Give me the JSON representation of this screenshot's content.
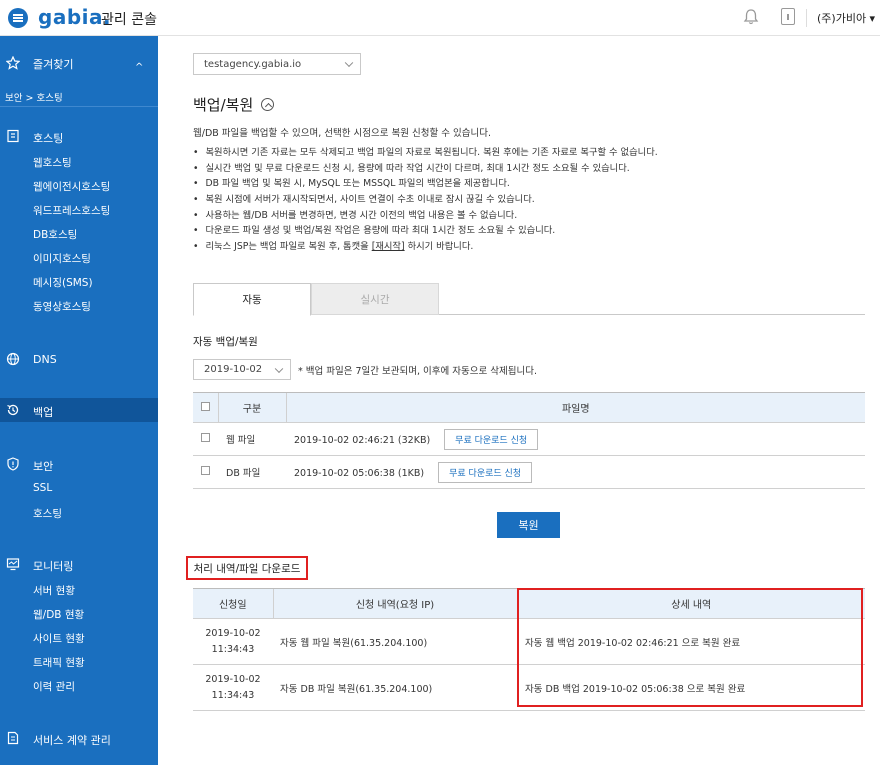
{
  "topbar": {
    "logo": "gabia.",
    "console_label": "관리 콘솔",
    "user": "(주)가비아 ▾"
  },
  "sidebar": {
    "favorites": "즐겨찾기",
    "breadcrumb": "보안 > 호스팅",
    "hosting_title": "호스팅",
    "hosting_items": [
      "웹호스팅",
      "웹에이전시호스팅",
      "워드프레스호스팅",
      "DB호스팅",
      "이미지호스팅",
      "메시징(SMS)",
      "동영상호스팅"
    ],
    "dns": "DNS",
    "backup": "백업",
    "security_title": "보안",
    "security_items": [
      "SSL",
      "호스팅"
    ],
    "monitoring_title": "모니터링",
    "monitoring_items": [
      "서버 현황",
      "웹/DB 현황",
      "사이트 현황",
      "트래픽 현황",
      "이력 관리"
    ],
    "contract": "서비스 계약 관리"
  },
  "main": {
    "site_select": "testagency.gabia.io",
    "title": "백업/복원",
    "description": "웹/DB 파일을 백업할 수 있으며, 선택한 시점으로 복원 신청할 수 있습니다.",
    "bullets": [
      "복원하시면 기존 자료는 모두 삭제되고 백업 파일의 자료로 복원됩니다. 복원 후에는 기존 자료로 복구할 수 없습니다.",
      "실시간 백업 및 무료 다운로드 신청 시, 용량에 따라 작업 시간이 다르며, 최대 1시간 정도 소요될 수 있습니다.",
      "DB 파일 백업 및 복원 시, MySQL 또는 MSSQL 파일의 백업본을 제공합니다.",
      "복원 시점에 서버가 재시작되면서, 사이트 연결이 수초 이내로 잠시 끊길 수 있습니다.",
      "사용하는 웹/DB 서버를 변경하면, 변경 시간 이전의 백업 내용은 볼 수 없습니다.",
      "다운로드 파일 생성 및 백업/복원 작업은 용량에 따라 최대 1시간 정도 소요될 수 있습니다."
    ],
    "last_bullet_pre": "리눅스 JSP는 백업 파일로 복원 후, 톰캣을 ",
    "last_bullet_link": "[재시작]",
    "last_bullet_post": " 하시기 바랍니다.",
    "tabs": [
      "자동",
      "실시간"
    ],
    "auto_title": "자동 백업/복원",
    "date_select": "2019-10-02",
    "retention_note": "* 백업 파일은 7일간 보관되며, 이후에 자동으로 삭제됩니다.",
    "backup_table": {
      "headers": [
        "구분",
        "파일명"
      ],
      "rows": [
        {
          "type": "웹 파일",
          "file": "2019-10-02 02:46:21 (32KB)",
          "button": "무료 다운로드 신청"
        },
        {
          "type": "DB 파일",
          "file": "2019-10-02 05:06:38 (1KB)",
          "button": "무료 다운로드 신청"
        }
      ]
    },
    "restore_button": "복원",
    "history_title": "처리 내역/파일 다운로드",
    "history_table": {
      "headers": [
        "신청일",
        "신청 내역(요청 IP)",
        "상세 내역"
      ],
      "rows": [
        {
          "date": "2019-10-02",
          "time": "11:34:43",
          "request": "자동 웹 파일 복원(61.35.204.100)",
          "detail": "자동 웹 백업 2019-10-02 02:46:21 으로 복원 완료"
        },
        {
          "date": "2019-10-02",
          "time": "11:34:43",
          "request": "자동 DB 파일 복원(61.35.204.100)",
          "detail": "자동 DB 백업 2019-10-02 05:06:38 으로 복원 완료"
        }
      ]
    }
  },
  "colors": {
    "brand": "#1a6fbf",
    "sidebar_active": "#10559a",
    "highlight": "#e02020"
  }
}
